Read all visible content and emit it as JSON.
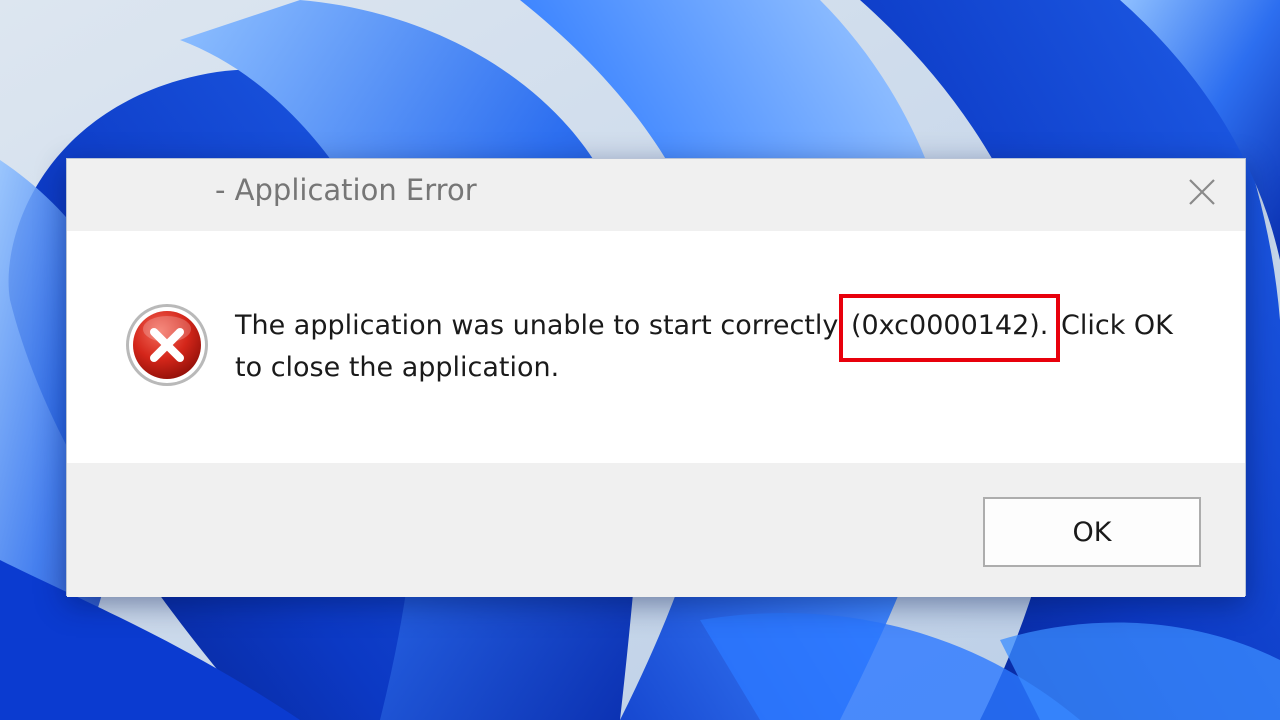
{
  "desktop": {
    "wallpaper_colors": {
      "dark": "#0a2fb0",
      "mid": "#2f6be0",
      "light": "#7fb0f7",
      "sky": "#c9d8ea"
    }
  },
  "dialog": {
    "title": "- Application Error",
    "close_icon": "close-icon",
    "icon": "error-icon",
    "message": {
      "before": "The application was unable to start correctly ",
      "error_code": "(0xc0000142).",
      "after": " Click OK to close the application."
    },
    "highlight_color": "#e8000c",
    "ok_label": "OK"
  }
}
